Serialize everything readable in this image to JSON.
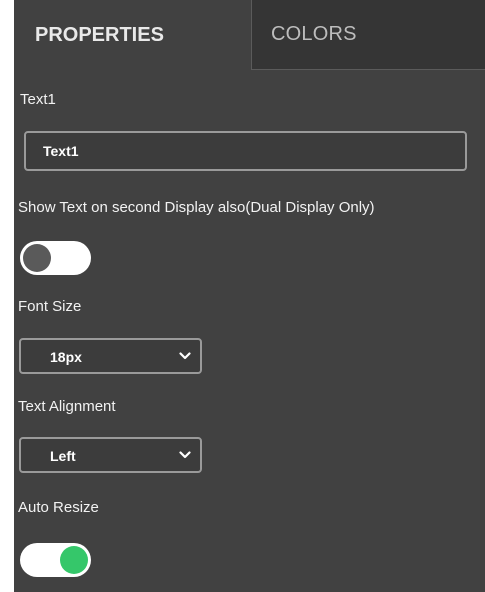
{
  "tabs": {
    "properties": "PROPERTIES",
    "colors": "COLORS"
  },
  "text_field": {
    "label": "Text1",
    "value": "Text1"
  },
  "second_display": {
    "label": "Show Text on second Display also(Dual Display Only)",
    "enabled": false
  },
  "font_size": {
    "label": "Font Size",
    "selected": "18px"
  },
  "text_alignment": {
    "label": "Text Alignment",
    "selected": "Left"
  },
  "auto_resize": {
    "label": "Auto Resize",
    "enabled": true
  },
  "colors": {
    "panel_bg": "#414141",
    "toggle_on": "#35c76a",
    "toggle_off_knob": "#5a5a5a"
  },
  "icons": {
    "select_arrow": "chevron-down-icon"
  }
}
